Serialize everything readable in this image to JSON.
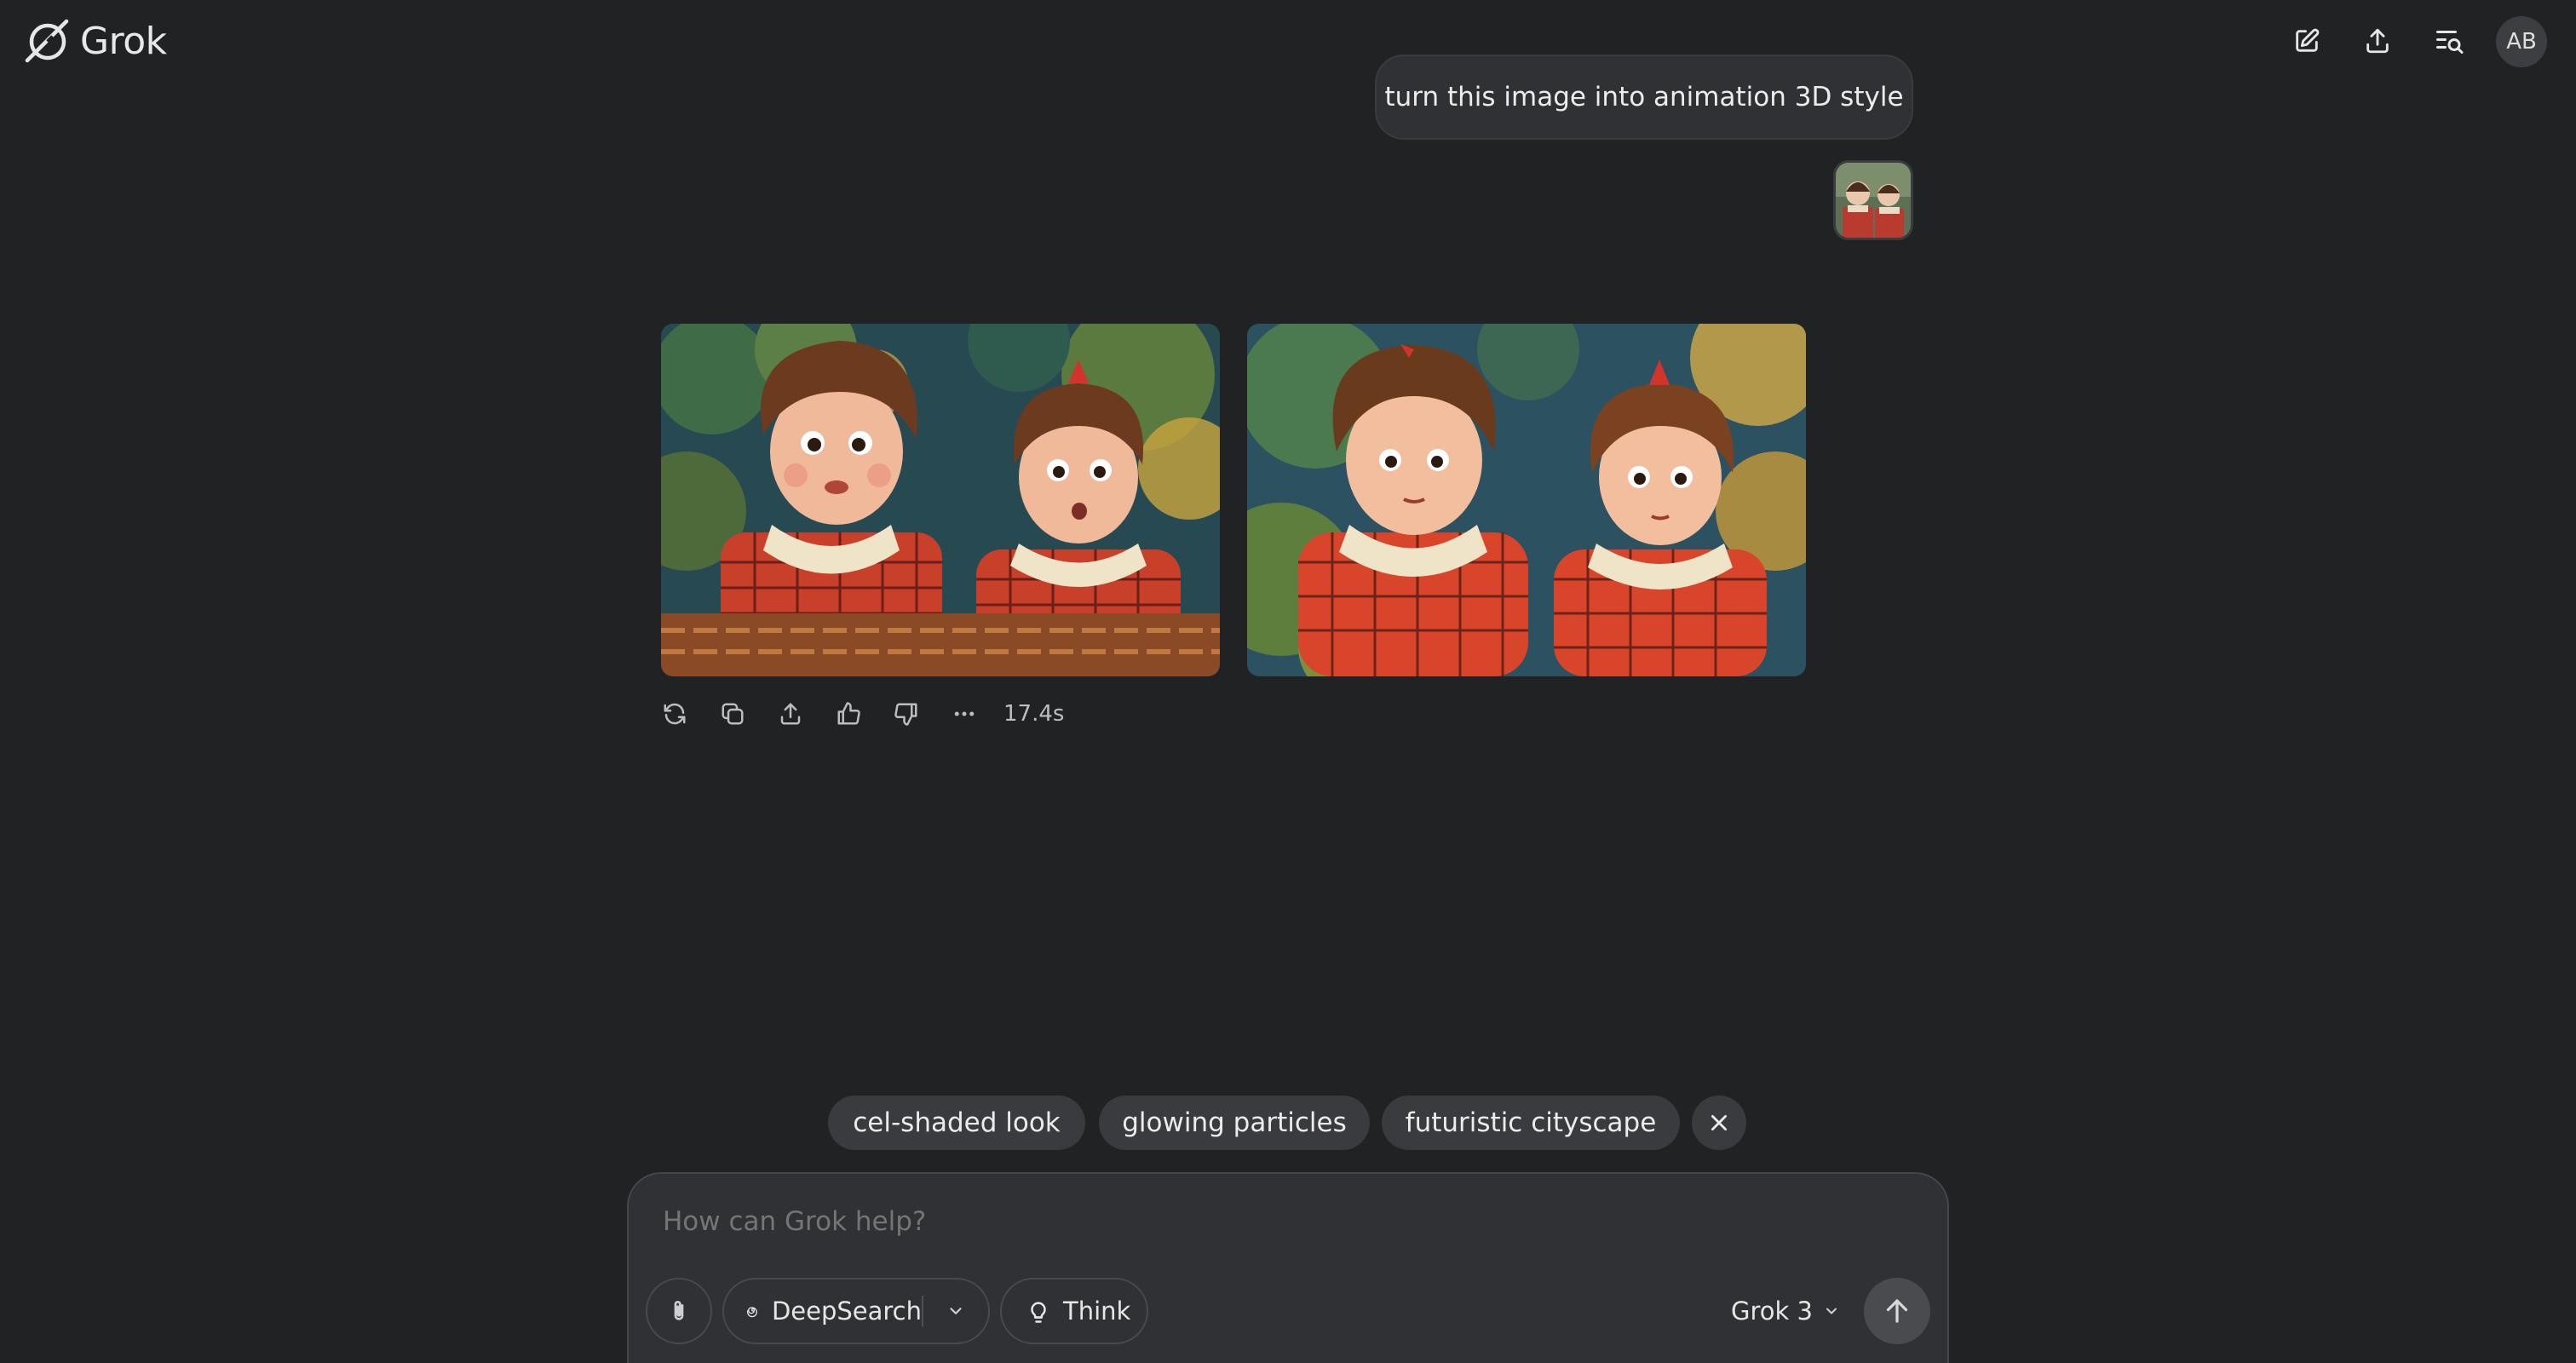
{
  "app": {
    "name": "Grok"
  },
  "header": {
    "new_chat_icon": "edit-pencil-icon",
    "share_icon": "upload-icon",
    "history_icon": "history-search-icon",
    "avatar_initials": "AB"
  },
  "conversation": {
    "user_message": "turn this image into animation 3D style",
    "response": {
      "images": [
        "generated-image-1",
        "generated-image-2"
      ],
      "actions": [
        "regenerate-icon",
        "copy-icon",
        "share-icon",
        "thumbs-up-icon",
        "thumbs-down-icon",
        "more-icon"
      ],
      "elapsed": "17.4s"
    }
  },
  "suggestions": [
    "cel-shaded look",
    "glowing particles",
    "futuristic cityscape"
  ],
  "composer": {
    "placeholder": "How can Grok help?",
    "deepsearch_label": "DeepSearch",
    "think_label": "Think",
    "model_label": "Grok 3"
  },
  "colors": {
    "background": "#212224",
    "bubble": "#303134",
    "chip": "#3a3b3e",
    "dress_red": "#d8452a",
    "collar_cream": "#efe3c8"
  }
}
